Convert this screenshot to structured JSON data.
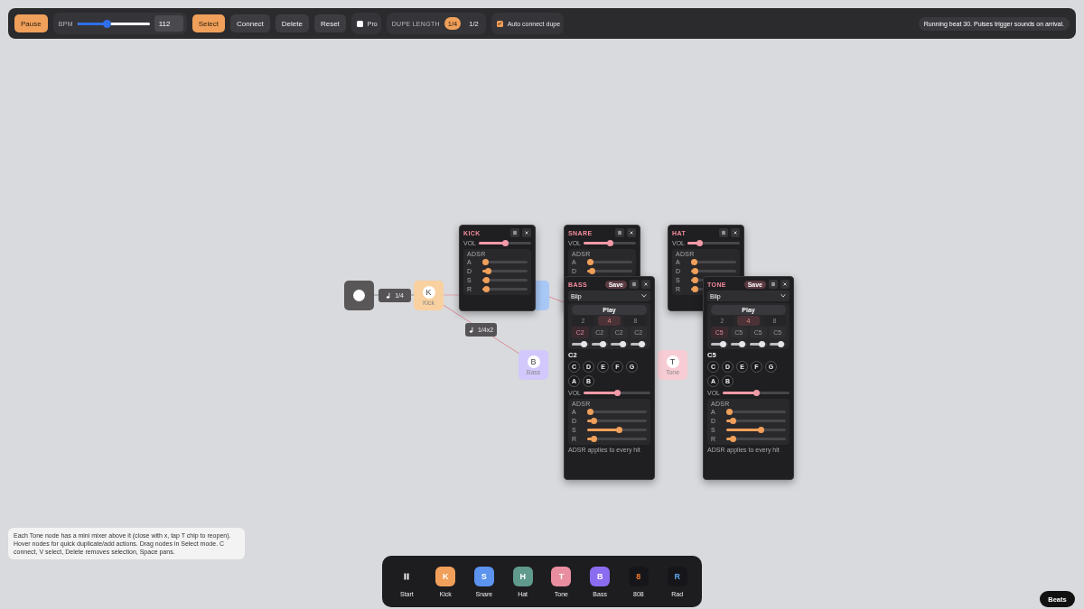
{
  "toolbar": {
    "pause_button": "Pause",
    "bpm": {
      "label": "BPM",
      "level": 0.4,
      "value": "112"
    },
    "tool_buttons": [
      {
        "label": "Select",
        "selected": true
      },
      {
        "label": "Connect",
        "selected": false
      },
      {
        "label": "Delete",
        "selected": false
      },
      {
        "label": "Reset",
        "selected": false
      }
    ],
    "pro": {
      "label": "Pro",
      "checked": false
    },
    "dupe_length": {
      "label": "DUPE LENGTH",
      "options": [
        {
          "label": "1/4",
          "selected": true
        },
        {
          "label": "1/2",
          "selected": false
        }
      ]
    },
    "auto_connect": {
      "label": "Auto connect dupe",
      "checked": true
    },
    "status": "Running beat 30. Pulses trigger sounds on arrival."
  },
  "canvas": {
    "nodes": [
      {
        "kind": "start"
      },
      {
        "kind": "sound",
        "letter": "K",
        "label": "Kick",
        "color": "#f9d1a0"
      },
      {
        "kind": "sound",
        "color": "#a8c8f6"
      },
      {
        "kind": "sound",
        "letter": "B",
        "label": "Bass",
        "color": "#d2c8fb"
      },
      {
        "kind": "sound",
        "letter": "T",
        "label": "Tone",
        "color": "#f8ccd4"
      }
    ],
    "chips": [
      {
        "label": "1/4"
      },
      {
        "label": "1/4x2"
      }
    ],
    "mixers": [
      {
        "kind": "mini",
        "title": "KICK",
        "vol": {
          "label": "VOL",
          "level": 0.5
        },
        "adsr": {
          "label": "ADSR",
          "rows": [
            {
              "label": "A",
              "level": 0
            },
            {
              "label": "D",
              "level": 0.08
            },
            {
              "label": "S",
              "level": 0.03
            },
            {
              "label": "R",
              "level": 0.03
            }
          ]
        }
      },
      {
        "kind": "mini",
        "title": "SNARE",
        "vol": {
          "label": "VOL",
          "level": 0.5
        },
        "adsr": {
          "label": "ADSR",
          "rows": [
            {
              "label": "A",
              "level": 0
            },
            {
              "label": "D",
              "level": 0.04
            }
          ]
        }
      },
      {
        "kind": "mini",
        "title": "HAT",
        "vol": {
          "label": "VOL",
          "level": 0.2
        },
        "adsr": {
          "label": "ADSR",
          "rows": [
            {
              "label": "A",
              "level": 0
            },
            {
              "label": "D",
              "level": 0.02
            },
            {
              "label": "S",
              "level": 0.02
            },
            {
              "label": "R",
              "level": 0.02
            }
          ]
        }
      },
      {
        "kind": "synth",
        "title": "BASS",
        "save": "Save",
        "preset": "Blip",
        "play": "Play",
        "steps": [
          {
            "label": "2",
            "selected": false
          },
          {
            "label": "4",
            "selected": true
          },
          {
            "label": "8",
            "selected": false
          }
        ],
        "notes": [
          {
            "label": "C2",
            "selected": true,
            "level": 0.85
          },
          {
            "label": "C2",
            "selected": false,
            "level": 0.85
          },
          {
            "label": "C2",
            "selected": false,
            "level": 0.85
          },
          {
            "label": "C2",
            "selected": false,
            "level": 0.85
          }
        ],
        "current_note": "C2",
        "keys": [
          "C",
          "D",
          "E",
          "F",
          "G",
          "A",
          "B"
        ],
        "vol": {
          "label": "VOL",
          "level": 0.5
        },
        "adsr": {
          "label": "ADSR",
          "rows": [
            {
              "label": "A",
              "level": 0
            },
            {
              "label": "D",
              "level": 0.06
            },
            {
              "label": "S",
              "level": 0.55
            },
            {
              "label": "R",
              "level": 0.06
            }
          ]
        },
        "footer": "ADSR applies to every hit"
      },
      {
        "kind": "synth",
        "title": "TONE",
        "save": "Save",
        "preset": "Blip",
        "play": "Play",
        "steps": [
          {
            "label": "2",
            "selected": false
          },
          {
            "label": "4",
            "selected": true
          },
          {
            "label": "8",
            "selected": false
          }
        ],
        "notes": [
          {
            "label": "C5",
            "selected": true,
            "level": 0.85
          },
          {
            "label": "C5",
            "selected": false,
            "level": 0.85
          },
          {
            "label": "C5",
            "selected": false,
            "level": 0.85
          },
          {
            "label": "C5",
            "selected": false,
            "level": 0.85
          }
        ],
        "current_note": "C5",
        "keys": [
          "C",
          "D",
          "E",
          "F",
          "G",
          "A",
          "B"
        ],
        "vol": {
          "label": "VOL",
          "level": 0.5
        },
        "adsr": {
          "label": "ADSR",
          "rows": [
            {
              "label": "A",
              "level": 0
            },
            {
              "label": "D",
              "level": 0.06
            },
            {
              "label": "S",
              "level": 0.6
            },
            {
              "label": "R",
              "level": 0.06
            }
          ]
        },
        "footer": "ADSR applies to every hit"
      }
    ]
  },
  "help": "Each Tone node has a mini mixer above it (close with x, tap T chip to reopen). Hover nodes for quick duplicate/add actions. Drag nodes in Select mode. C connect, V select, Delete removes selection, Space pans.",
  "dock": [
    {
      "kind": "control",
      "label": "Start"
    },
    {
      "kind": "sound",
      "letter": "K",
      "label": "Kick",
      "color": "#f0a05a"
    },
    {
      "kind": "sound",
      "letter": "S",
      "label": "Snare",
      "color": "#5b93ef"
    },
    {
      "kind": "sound",
      "letter": "H",
      "label": "Hat",
      "color": "#5f9a8c"
    },
    {
      "kind": "sound",
      "letter": "T",
      "label": "Tone",
      "color": "#e98ea0"
    },
    {
      "kind": "sound",
      "letter": "B",
      "label": "Bass",
      "color": "#8a6cf0"
    },
    {
      "kind": "dark",
      "letter": "8",
      "label": "808",
      "color": "#f07a2a"
    },
    {
      "kind": "dark",
      "letter": "R",
      "label": "Rad",
      "color": "#5fa6ec"
    }
  ],
  "beats_button": "Beats"
}
